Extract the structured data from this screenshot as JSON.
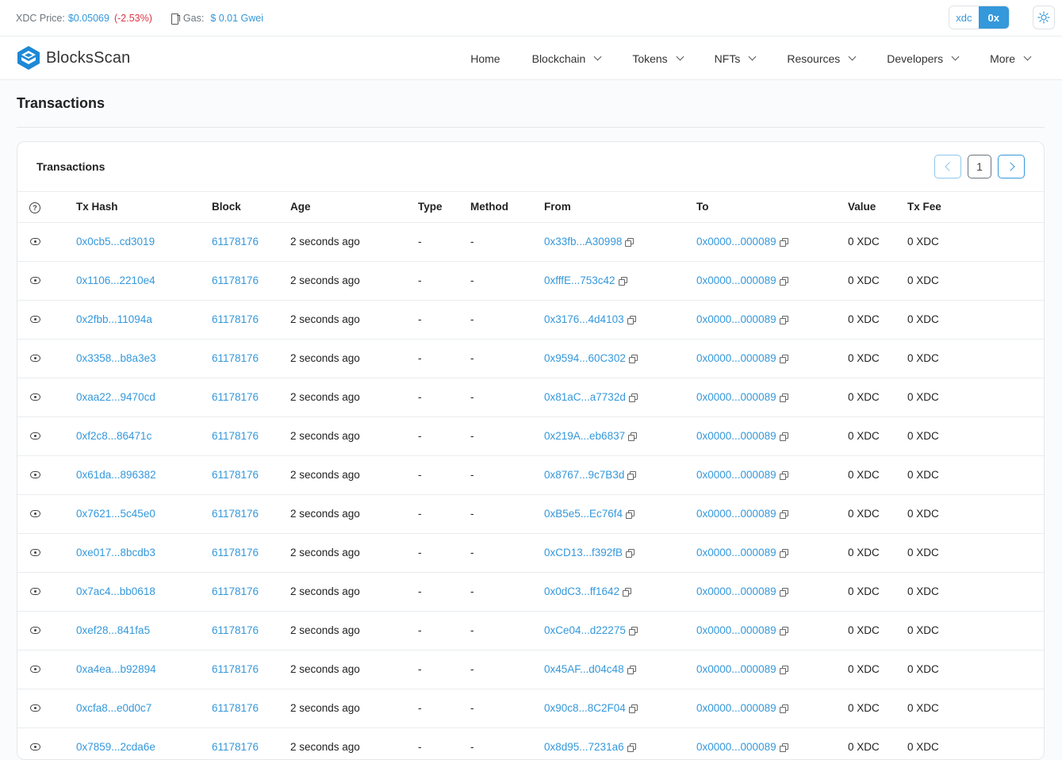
{
  "topbar": {
    "price_label": "XDC Price:",
    "price_value": "$0.05069",
    "price_change": "(-2.53%)",
    "gas_label": "Gas:",
    "gas_value": "$ 0.01 Gwei",
    "prefix_options": [
      "xdc",
      "0x"
    ],
    "prefix_selected": "0x",
    "theme_icon": "sun-icon"
  },
  "navbar": {
    "logo_text": "BlocksScan",
    "items": [
      {
        "label": "Home",
        "dropdown": false
      },
      {
        "label": "Blockchain",
        "dropdown": true
      },
      {
        "label": "Tokens",
        "dropdown": true
      },
      {
        "label": "NFTs",
        "dropdown": true
      },
      {
        "label": "Resources",
        "dropdown": true
      },
      {
        "label": "Developers",
        "dropdown": true
      },
      {
        "label": "More",
        "dropdown": true
      }
    ]
  },
  "page": {
    "title": "Transactions"
  },
  "card": {
    "title": "Transactions",
    "pager": {
      "current_page": "1"
    }
  },
  "table": {
    "columns": [
      "",
      "Tx Hash",
      "Block",
      "Age",
      "Type",
      "Method",
      "From",
      "To",
      "Value",
      "Tx Fee"
    ],
    "rows": [
      {
        "hash": "0x0cb5...cd3019",
        "block": "61178176",
        "age": "2 seconds ago",
        "type": "-",
        "method": "-",
        "from": "0x33fb...A30998",
        "to": "0x0000...000089",
        "value": "0 XDC",
        "fee": "0 XDC"
      },
      {
        "hash": "0x1106...2210e4",
        "block": "61178176",
        "age": "2 seconds ago",
        "type": "-",
        "method": "-",
        "from": "0xfffE...753c42",
        "to": "0x0000...000089",
        "value": "0 XDC",
        "fee": "0 XDC"
      },
      {
        "hash": "0x2fbb...11094a",
        "block": "61178176",
        "age": "2 seconds ago",
        "type": "-",
        "method": "-",
        "from": "0x3176...4d4103",
        "to": "0x0000...000089",
        "value": "0 XDC",
        "fee": "0 XDC"
      },
      {
        "hash": "0x3358...b8a3e3",
        "block": "61178176",
        "age": "2 seconds ago",
        "type": "-",
        "method": "-",
        "from": "0x9594...60C302",
        "to": "0x0000...000089",
        "value": "0 XDC",
        "fee": "0 XDC"
      },
      {
        "hash": "0xaa22...9470cd",
        "block": "61178176",
        "age": "2 seconds ago",
        "type": "-",
        "method": "-",
        "from": "0x81aC...a7732d",
        "to": "0x0000...000089",
        "value": "0 XDC",
        "fee": "0 XDC"
      },
      {
        "hash": "0xf2c8...86471c",
        "block": "61178176",
        "age": "2 seconds ago",
        "type": "-",
        "method": "-",
        "from": "0x219A...eb6837",
        "to": "0x0000...000089",
        "value": "0 XDC",
        "fee": "0 XDC"
      },
      {
        "hash": "0x61da...896382",
        "block": "61178176",
        "age": "2 seconds ago",
        "type": "-",
        "method": "-",
        "from": "0x8767...9c7B3d",
        "to": "0x0000...000089",
        "value": "0 XDC",
        "fee": "0 XDC"
      },
      {
        "hash": "0x7621...5c45e0",
        "block": "61178176",
        "age": "2 seconds ago",
        "type": "-",
        "method": "-",
        "from": "0xB5e5...Ec76f4",
        "to": "0x0000...000089",
        "value": "0 XDC",
        "fee": "0 XDC"
      },
      {
        "hash": "0xe017...8bcdb3",
        "block": "61178176",
        "age": "2 seconds ago",
        "type": "-",
        "method": "-",
        "from": "0xCD13...f392fB",
        "to": "0x0000...000089",
        "value": "0 XDC",
        "fee": "0 XDC"
      },
      {
        "hash": "0x7ac4...bb0618",
        "block": "61178176",
        "age": "2 seconds ago",
        "type": "-",
        "method": "-",
        "from": "0x0dC3...ff1642",
        "to": "0x0000...000089",
        "value": "0 XDC",
        "fee": "0 XDC"
      },
      {
        "hash": "0xef28...841fa5",
        "block": "61178176",
        "age": "2 seconds ago",
        "type": "-",
        "method": "-",
        "from": "0xCe04...d22275",
        "to": "0x0000...000089",
        "value": "0 XDC",
        "fee": "0 XDC"
      },
      {
        "hash": "0xa4ea...b92894",
        "block": "61178176",
        "age": "2 seconds ago",
        "type": "-",
        "method": "-",
        "from": "0x45AF...d04c48",
        "to": "0x0000...000089",
        "value": "0 XDC",
        "fee": "0 XDC"
      },
      {
        "hash": "0xcfa8...e0d0c7",
        "block": "61178176",
        "age": "2 seconds ago",
        "type": "-",
        "method": "-",
        "from": "0x90c8...8C2F04",
        "to": "0x0000...000089",
        "value": "0 XDC",
        "fee": "0 XDC"
      },
      {
        "hash": "0x7859...2cda6e",
        "block": "61178176",
        "age": "2 seconds ago",
        "type": "-",
        "method": "-",
        "from": "0x8d95...7231a6",
        "to": "0x0000...000089",
        "value": "0 XDC",
        "fee": "0 XDC"
      }
    ]
  },
  "colors": {
    "accent": "#3498db",
    "negative": "#dc3545"
  }
}
